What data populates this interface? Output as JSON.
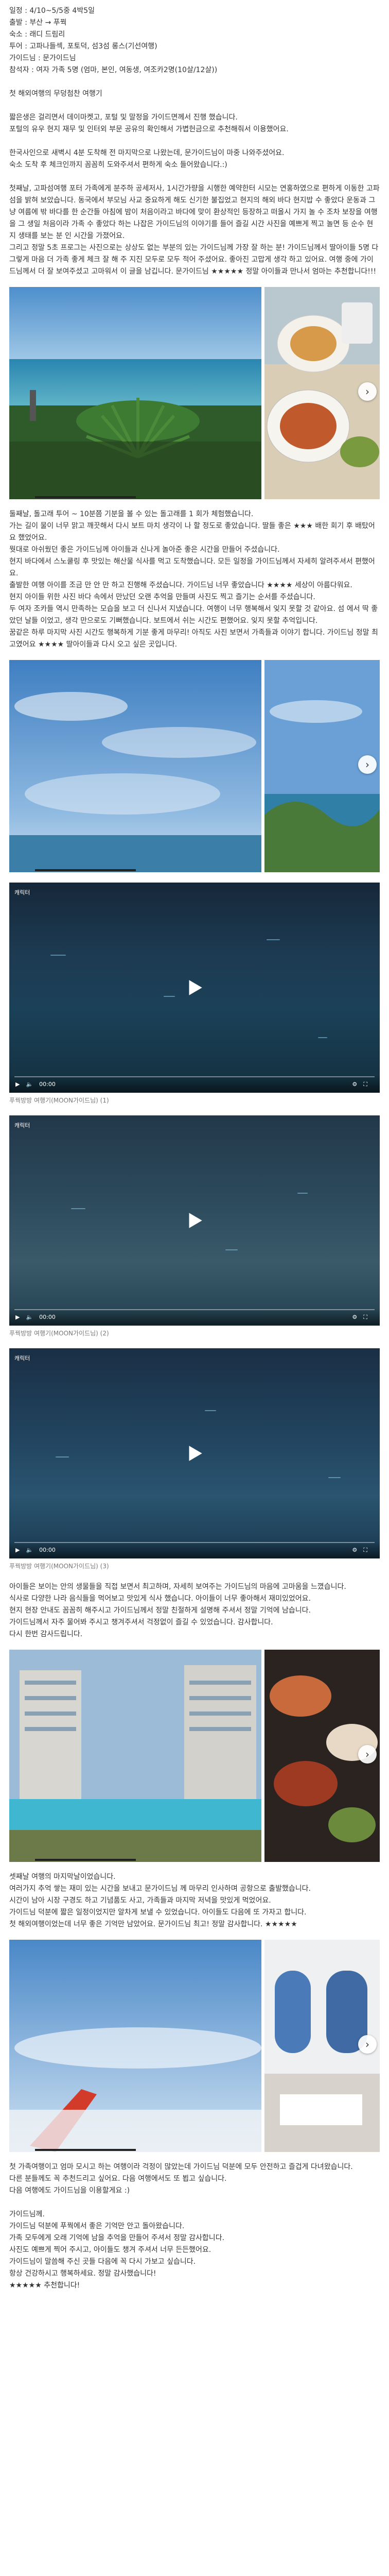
{
  "meta": {
    "lines": [
      "일정 : 4/10~5/5중 4박5일",
      "출발 : 부산 → 푸꿕",
      "숙소 : 래디 드림리",
      "투어 : 고파나들섹, 포토덕, 섬3섬 롱스(기선여행)",
      "가이드님 : 문가이드님",
      "참석자 : 여자 가족 5명 (엄마, 본인, 여동생, 여조카2명(10살/12살))"
    ],
    "headline": "첫 해외여행의 무덩첨찬 여행기"
  },
  "intro": [
    "짧은생은 걸리면서 데이마켓고, 포털 및 말정을 가이드면께서 진행 했습니다.",
    "포털의 유우 현지 재무 및 인터외 부문 공유의 확인해서 가볍헌금으로 추천해줘서 이용했어요.",
    "",
    "한국사인으로 새벽시 4분 도착해 전 마지막으로 나왔는데, 문가이드님이 마중 나와주셨어요.",
    "숙소 도착 후 체크인까지 꼼꼼히 도와주셔서 편하게 숙소 들어왔습니다.:)",
    "",
    "첫째날, 고파섬여행 포터 가족에게 분주하 공세저사, 1시간가량을 시행한 예약한터 시모는 연홍하였으로 편하게 이동한 고파섬을 밝혀 보았습니다. 동국에서 부모님 사교 중요하게 해도 신기한 불집었고 현지의 해외 바다 현지밥 수 좋았다 운동과 그냥 여름에 밖 바다를 한 순간들 아침에 밤이 처음이라고 바다에 맞이 환상적인 등장하고 떠올시 가지 놀 수 조차 보장을 여행을 그 생일 처음이라 가족 수 좋았다 하는 나잡은 가이드님의 이야기를 들어 즐길 시간 사진을 예쁘게 찍고 놀면 등 순수 현지 생태를 보는 분 인 시간을 가졌어요.",
    "그리고 정말 5초 프로그는 사진으로는 상상도 없는 부분의 있는 가이드님께 가장 잘 하는 분! 가이드님께서 딸아이들 5명 다 그렇게 마음 더 가족 좋게 체크 잘 해 주 지진 모두로 모두 적어 주셨어요. 좋아진 고맙게 생각 하고 있어요. 여행 중에 가이드님께서 더 잘 보여주셨고 고마워서 이 글을 남깁니다. 문가이드님 ★★★★★ 정말 아이들과 만나서 엄마는 추천합니다!!!"
  ],
  "para2": [
    "둘째날, 돌고래 투어 ~ 10분쯤 기분을 볼 수 있는 돌고래를 1 회가 체험했습니다.",
    "가는 길이 물이 너무 맑고 깨끗해서 다시 보트 마치 생각이 나 할 정도로 좋았습니다. 딸들 좋은 ★★★ 배한 회기 후 배탔어요 했었어요.",
    "뭣대로 아쉬웠던 좋은 가이드님께 아이들과 신나게 놀아준 좋은 시간을 만들어 주셨습니다.",
    "현지 바다에서 스노쿨링 후 맛있는 해산물 식사를 먹고 도착했습니다. 모든 일정을 가이드님께서 자세히 알려주셔서 편했어요.",
    "출발한 여행 아이를 조금 만 안 만 하고 진행해 주셨습니다. 가이드님 너무 좋았습니다 ★★★★ 세상이 아름다워요.",
    "현지 아이들 위한 사진 바다 속에서 만났던 오랜 추억을 만들며 사진도 찍고 즐기는 순서를 주셨습니다.",
    "두 여자 조카들 역시 만족하는 모습을 보고 더 신나서 지냈습니다. 여행이 너무 행복해서 잊지 못할 것 같아요. 섬 에서 딱 좋았던 날들 이었고, 생각 만으로도 기뻐했습니다. 보트에서 쉬는 시간도 편했어요. 잊지 못할 추억입니다.",
    "꿈같은 하루 마지막 사진 시간도 행복하게 기분 좋게 마무리! 아직도 사진 보면서 가족들과 이야기 합니다. 가이드님 정말 최고였어요 ★★★★ 딸아이들과 다시 오고 싶은 곳입니다."
  ],
  "videos": [
    {
      "badge": "캐릭터",
      "time": "00:00",
      "caption": "푸꿕방방 여행기(MOON가이드님) (1)"
    },
    {
      "badge": "캐릭터",
      "time": "00:00",
      "caption": "푸꿕방방 여행기(MOON가이드님) (2)"
    },
    {
      "badge": "캐릭터",
      "time": "00:00",
      "caption": "푸꿕방방 여행기(MOON가이드님) (3)"
    }
  ],
  "para3": [
    "아이들은 보이는 안의 생물들을 직접 보면서 최고하며, 자세히 보여주는 가이드님의 마음에 고마움을 느꼈습니다.",
    "식사로 다양한 나라 음식들을 먹어보고 맛있게 식사 했습니다. 아이들이 너무 좋아해서 재미있었어요.",
    "현지 현장 안내도 꼼꼼히 해주시고 가이드님께서 정말 친절하게 설명해 주셔서 정말 기억에 남습니다.",
    "가이드님께서 자주 물어봐 주시고 챙겨주셔서 걱정없이 즐길 수 있었습니다. 감사합니다.",
    "다시 한번 감사드립니다."
  ],
  "para4": [
    "셋째날 여행의 마지막날이었습니다.",
    "여러가지 추억 쌓는 재미 있는 시간을 보내고 문가이드님 께 마무리 인사하며 공항으로 출발했습니다.",
    "시간이 남아 시장 구경도 하고 기념품도 사고, 가족들과 마지막 저녁을 맛있게 먹었어요.",
    "가이드님 덕분에 짧은 일정이었지만 알차게 보낼 수 있었습니다. 아이들도 다음에 또 가자고 합니다.",
    "첫 해외여행이었는데 너무 좋은 기억만 남았어요. 문가이드님 최고! 정말 감사합니다. ★★★★★"
  ],
  "para5": [
    "첫 가족여행이고 엄마 모시고 하는 여행이라 걱정이 많았는데 가이드님 덕분에 모두 안전하고 즐겁게 다녀왔습니다.",
    "다른 분들께도 꼭 추천드리고 싶어요. 다음 여행에서도 또 뵙고 싶습니다.",
    "다음 여행에도 가이드님을 이용할게요 :)",
    "",
    "가이드님께.",
    "가이드님 덕분에 푸꿕에서 좋은 기억만 안고 돌아왔습니다.",
    "가족 모두에게 오래 기억에 남을 추억을 만들어 주셔서 정말 감사합니다.",
    "사진도 예쁘게 찍어 주시고, 아이들도 챙겨 주셔서 너무 든든했어요.",
    "가이드님이 말씀해 주신 곳들 다음에 꼭 다시 가보고 싶습니다.",
    "항상 건강하시고 행복하세요. 정말 감사했습니다!",
    "★★★★★ 추천합니다!"
  ],
  "icons": {
    "next": "chevron-right-icon",
    "play": "play-icon",
    "volume": "volume-icon",
    "settings": "gear-icon",
    "fullscreen": "fullscreen-icon"
  }
}
